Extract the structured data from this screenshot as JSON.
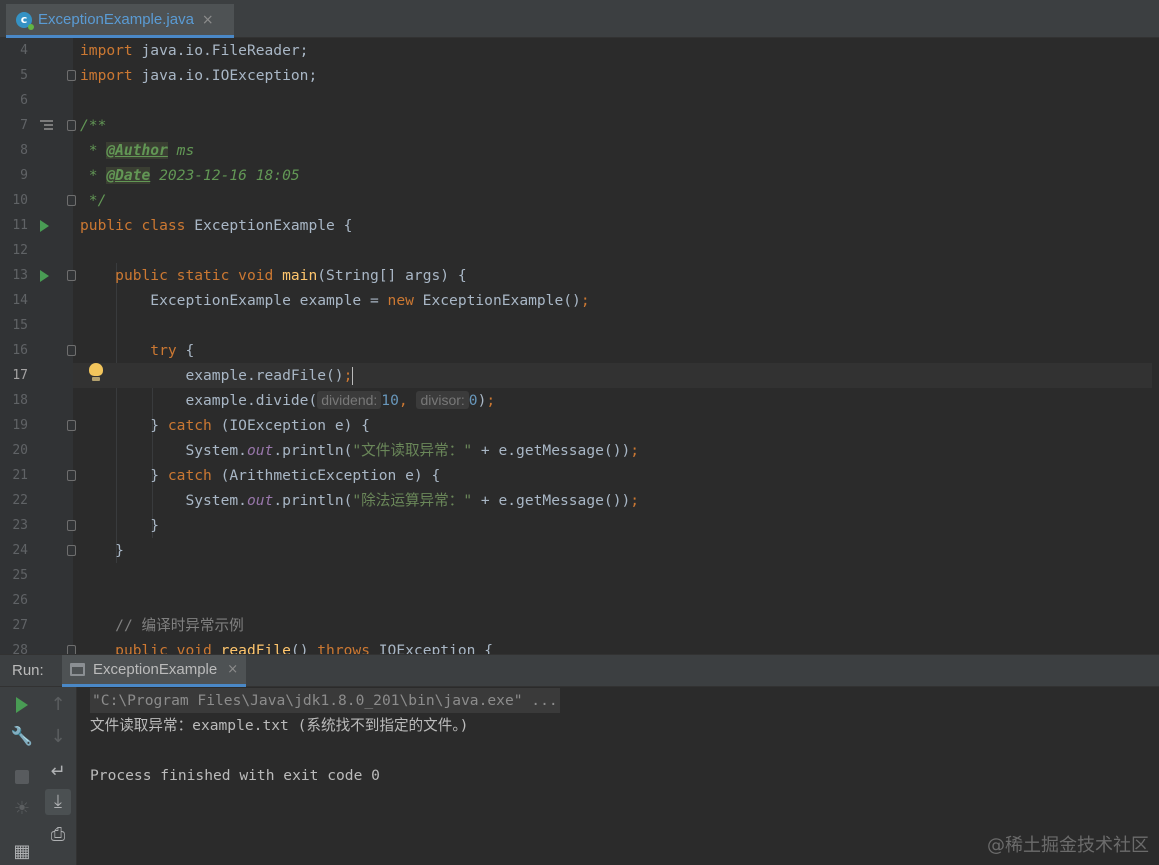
{
  "tab": {
    "icon": "java-class-icon",
    "icon_letter": "c",
    "label": "ExceptionExample.java",
    "close": "×"
  },
  "editor": {
    "current_line": 17,
    "lines": [
      {
        "n": "4"
      },
      {
        "n": "5"
      },
      {
        "n": "6"
      },
      {
        "n": "7"
      },
      {
        "n": "8"
      },
      {
        "n": "9"
      },
      {
        "n": "10"
      },
      {
        "n": "11"
      },
      {
        "n": "12"
      },
      {
        "n": "13"
      },
      {
        "n": "14"
      },
      {
        "n": "15"
      },
      {
        "n": "16"
      },
      {
        "n": "17"
      },
      {
        "n": "18"
      },
      {
        "n": "19"
      },
      {
        "n": "20"
      },
      {
        "n": "21"
      },
      {
        "n": "22"
      },
      {
        "n": "23"
      },
      {
        "n": "24"
      },
      {
        "n": "25"
      },
      {
        "n": "26"
      },
      {
        "n": "27"
      },
      {
        "n": "28"
      }
    ],
    "code": {
      "l4_kw": "import",
      "l4_rest": " java.io.FileReader;",
      "l5_kw": "import",
      "l5_rest": " java.io.IOException;",
      "l7": "/**",
      "l8_star": " * ",
      "l8_tag": "@Author",
      "l8_val": " ms",
      "l9_star": " * ",
      "l9_tag": "@Date",
      "l9_val": " 2023-12-16 18:05",
      "l10": " */",
      "l11_kw": "public class",
      "l11_rest": " ExceptionExample {",
      "l13_kw": "public static void",
      "l13_fn": "main",
      "l13_rest": "(String[] args) {",
      "l14_a": "ExceptionExample example = ",
      "l14_kw": "new",
      "l14_b": " ExceptionExample()",
      "l14_semi": ";",
      "l16_kw": "try",
      "l16_rest": " {",
      "l17_a": "example.readFile()",
      "l17_semi": ";",
      "l18_a": "example.divide(",
      "l18_h1": "dividend:",
      "l18_v1": "10",
      "l18_comma": ", ",
      "l18_h2": "divisor:",
      "l18_v2": "0",
      "l18_b": ")",
      "l18_semi": ";",
      "l19_a": "} ",
      "l19_kw": "catch",
      "l19_rest": " (IOException e) {",
      "l20_a": "System.",
      "l20_out": "out",
      "l20_b": ".println(",
      "l20_str": "\"文件读取异常：\"",
      "l20_c": " + e.getMessage())",
      "l20_semi": ";",
      "l21_a": "} ",
      "l21_kw": "catch",
      "l21_rest": " (ArithmeticException e) {",
      "l22_a": "System.",
      "l22_out": "out",
      "l22_b": ".println(",
      "l22_str": "\"除法运算异常：\"",
      "l22_c": " + e.getMessage())",
      "l22_semi": ";",
      "l23": "}",
      "l24": "}",
      "l27": "// 编译时异常示例",
      "l28_kw": "public void",
      "l28_fn": "readFile",
      "l28_rest": "() ",
      "l28_kw2": "throws",
      "l28_rest2": " IOException {"
    }
  },
  "run": {
    "title": "Run:",
    "tab_label": "ExceptionExample",
    "tab_close": "×",
    "console": {
      "cmdline": "\"C:\\Program Files\\Java\\jdk1.8.0_201\\bin\\java.exe\" ...",
      "line1": "文件读取异常：example.txt (系统找不到指定的文件。)",
      "line2": "Process finished with exit code 0"
    }
  },
  "watermark": "@稀土掘金技术社区",
  "colors": {
    "background": "#2b2b2b",
    "keyword": "#cc7832",
    "string": "#6a8759",
    "function": "#ffc66d",
    "number": "#6897bb",
    "run_green": "#499c54"
  }
}
